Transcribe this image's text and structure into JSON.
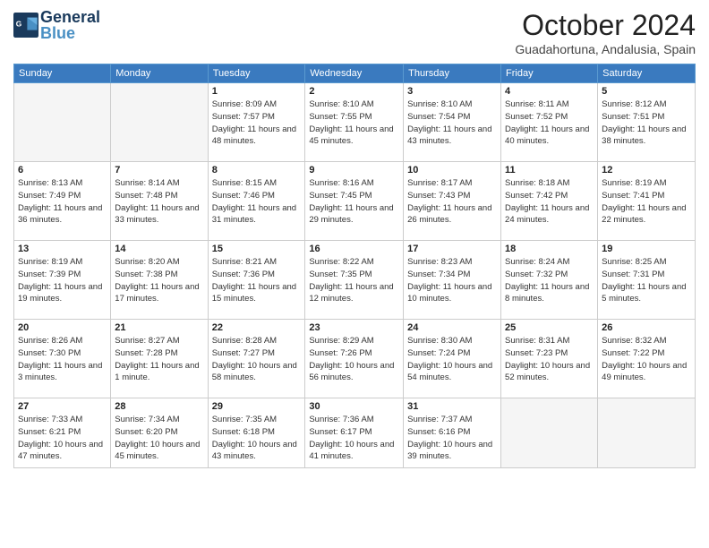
{
  "header": {
    "logo_general": "General",
    "logo_blue": "Blue",
    "month_title": "October 2024",
    "location": "Guadahortuna, Andalusia, Spain"
  },
  "days_of_week": [
    "Sunday",
    "Monday",
    "Tuesday",
    "Wednesday",
    "Thursday",
    "Friday",
    "Saturday"
  ],
  "weeks": [
    [
      {
        "day": "",
        "info": ""
      },
      {
        "day": "",
        "info": ""
      },
      {
        "day": "1",
        "info": "Sunrise: 8:09 AM\nSunset: 7:57 PM\nDaylight: 11 hours and 48 minutes."
      },
      {
        "day": "2",
        "info": "Sunrise: 8:10 AM\nSunset: 7:55 PM\nDaylight: 11 hours and 45 minutes."
      },
      {
        "day": "3",
        "info": "Sunrise: 8:10 AM\nSunset: 7:54 PM\nDaylight: 11 hours and 43 minutes."
      },
      {
        "day": "4",
        "info": "Sunrise: 8:11 AM\nSunset: 7:52 PM\nDaylight: 11 hours and 40 minutes."
      },
      {
        "day": "5",
        "info": "Sunrise: 8:12 AM\nSunset: 7:51 PM\nDaylight: 11 hours and 38 minutes."
      }
    ],
    [
      {
        "day": "6",
        "info": "Sunrise: 8:13 AM\nSunset: 7:49 PM\nDaylight: 11 hours and 36 minutes."
      },
      {
        "day": "7",
        "info": "Sunrise: 8:14 AM\nSunset: 7:48 PM\nDaylight: 11 hours and 33 minutes."
      },
      {
        "day": "8",
        "info": "Sunrise: 8:15 AM\nSunset: 7:46 PM\nDaylight: 11 hours and 31 minutes."
      },
      {
        "day": "9",
        "info": "Sunrise: 8:16 AM\nSunset: 7:45 PM\nDaylight: 11 hours and 29 minutes."
      },
      {
        "day": "10",
        "info": "Sunrise: 8:17 AM\nSunset: 7:43 PM\nDaylight: 11 hours and 26 minutes."
      },
      {
        "day": "11",
        "info": "Sunrise: 8:18 AM\nSunset: 7:42 PM\nDaylight: 11 hours and 24 minutes."
      },
      {
        "day": "12",
        "info": "Sunrise: 8:19 AM\nSunset: 7:41 PM\nDaylight: 11 hours and 22 minutes."
      }
    ],
    [
      {
        "day": "13",
        "info": "Sunrise: 8:19 AM\nSunset: 7:39 PM\nDaylight: 11 hours and 19 minutes."
      },
      {
        "day": "14",
        "info": "Sunrise: 8:20 AM\nSunset: 7:38 PM\nDaylight: 11 hours and 17 minutes."
      },
      {
        "day": "15",
        "info": "Sunrise: 8:21 AM\nSunset: 7:36 PM\nDaylight: 11 hours and 15 minutes."
      },
      {
        "day": "16",
        "info": "Sunrise: 8:22 AM\nSunset: 7:35 PM\nDaylight: 11 hours and 12 minutes."
      },
      {
        "day": "17",
        "info": "Sunrise: 8:23 AM\nSunset: 7:34 PM\nDaylight: 11 hours and 10 minutes."
      },
      {
        "day": "18",
        "info": "Sunrise: 8:24 AM\nSunset: 7:32 PM\nDaylight: 11 hours and 8 minutes."
      },
      {
        "day": "19",
        "info": "Sunrise: 8:25 AM\nSunset: 7:31 PM\nDaylight: 11 hours and 5 minutes."
      }
    ],
    [
      {
        "day": "20",
        "info": "Sunrise: 8:26 AM\nSunset: 7:30 PM\nDaylight: 11 hours and 3 minutes."
      },
      {
        "day": "21",
        "info": "Sunrise: 8:27 AM\nSunset: 7:28 PM\nDaylight: 11 hours and 1 minute."
      },
      {
        "day": "22",
        "info": "Sunrise: 8:28 AM\nSunset: 7:27 PM\nDaylight: 10 hours and 58 minutes."
      },
      {
        "day": "23",
        "info": "Sunrise: 8:29 AM\nSunset: 7:26 PM\nDaylight: 10 hours and 56 minutes."
      },
      {
        "day": "24",
        "info": "Sunrise: 8:30 AM\nSunset: 7:24 PM\nDaylight: 10 hours and 54 minutes."
      },
      {
        "day": "25",
        "info": "Sunrise: 8:31 AM\nSunset: 7:23 PM\nDaylight: 10 hours and 52 minutes."
      },
      {
        "day": "26",
        "info": "Sunrise: 8:32 AM\nSunset: 7:22 PM\nDaylight: 10 hours and 49 minutes."
      }
    ],
    [
      {
        "day": "27",
        "info": "Sunrise: 7:33 AM\nSunset: 6:21 PM\nDaylight: 10 hours and 47 minutes."
      },
      {
        "day": "28",
        "info": "Sunrise: 7:34 AM\nSunset: 6:20 PM\nDaylight: 10 hours and 45 minutes."
      },
      {
        "day": "29",
        "info": "Sunrise: 7:35 AM\nSunset: 6:18 PM\nDaylight: 10 hours and 43 minutes."
      },
      {
        "day": "30",
        "info": "Sunrise: 7:36 AM\nSunset: 6:17 PM\nDaylight: 10 hours and 41 minutes."
      },
      {
        "day": "31",
        "info": "Sunrise: 7:37 AM\nSunset: 6:16 PM\nDaylight: 10 hours and 39 minutes."
      },
      {
        "day": "",
        "info": ""
      },
      {
        "day": "",
        "info": ""
      }
    ]
  ]
}
